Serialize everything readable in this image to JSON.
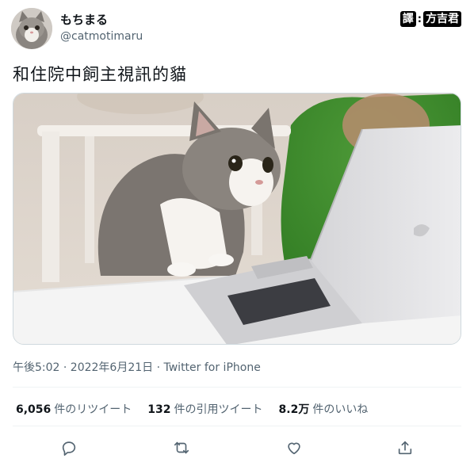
{
  "user": {
    "display_name": "もちまる",
    "handle": "@catmotimaru"
  },
  "watermark": {
    "left": "譯",
    "separator": ":",
    "right": "方吉君"
  },
  "tweet": {
    "text": "和住院中飼主視訊的貓",
    "meta": "午後5:02 · 2022年6月21日 · Twitter for iPhone"
  },
  "stats": [
    {
      "value": "6,056",
      "label": "件のリツイート"
    },
    {
      "value": "132",
      "label": "件の引用ツイート"
    },
    {
      "value": "8.2万",
      "label": "件のいいね"
    }
  ],
  "icons": {
    "reply": "reply-icon",
    "retweet": "retweet-icon",
    "like": "like-icon",
    "share": "share-icon"
  }
}
